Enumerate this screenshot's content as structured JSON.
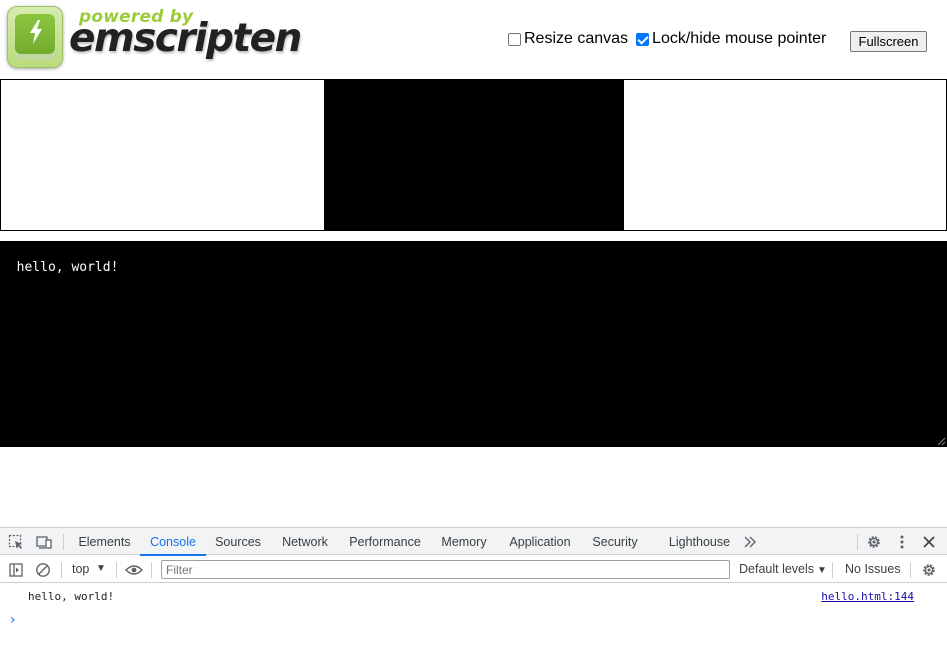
{
  "header": {
    "powered_by": "powered by",
    "brand": "emscripten",
    "resize_canvas_label": "Resize canvas",
    "resize_canvas_checked": false,
    "lock_pointer_label": "Lock/hide mouse pointer",
    "lock_pointer_checked": true,
    "fullscreen_label": "Fullscreen"
  },
  "output": {
    "text": "hello, world!"
  },
  "devtools": {
    "tabs": [
      {
        "label": "Elements",
        "active": false
      },
      {
        "label": "Console",
        "active": true
      },
      {
        "label": "Sources",
        "active": false
      },
      {
        "label": "Network",
        "active": false
      },
      {
        "label": "Performance",
        "active": false
      },
      {
        "label": "Memory",
        "active": false
      },
      {
        "label": "Application",
        "active": false
      },
      {
        "label": "Security",
        "active": false
      },
      {
        "label": "Lighthouse",
        "active": false
      }
    ],
    "more_tabs_icon": "double-chevron-right-icon",
    "toolbar": {
      "context": "top",
      "filter_placeholder": "Filter",
      "levels": "Default levels",
      "issues": "No Issues"
    },
    "console": {
      "messages": [
        {
          "text": "hello, world!",
          "source": "hello.html:144"
        }
      ],
      "prompt": "›"
    },
    "accent_color": "#1a73e8"
  }
}
